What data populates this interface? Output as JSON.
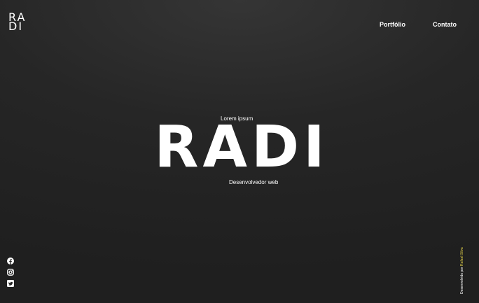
{
  "logo": {
    "line1": "RA",
    "line2": "DI"
  },
  "nav": {
    "items": [
      {
        "label": "Portfólio"
      },
      {
        "label": "Contato"
      }
    ]
  },
  "hero": {
    "kicker": "Lorem ipsum",
    "title": "RADI",
    "subtitle": "Desenvolvedor web"
  },
  "social": {
    "icons": [
      "facebook-icon",
      "instagram-icon",
      "twitter-icon"
    ]
  },
  "footer": {
    "credit_prefix": "Desenvolvido por",
    "credit_name": "Rafael Silva"
  },
  "colors": {
    "background": "#262626",
    "text": "#ffffff",
    "credit_accent": "#e6d44a"
  }
}
